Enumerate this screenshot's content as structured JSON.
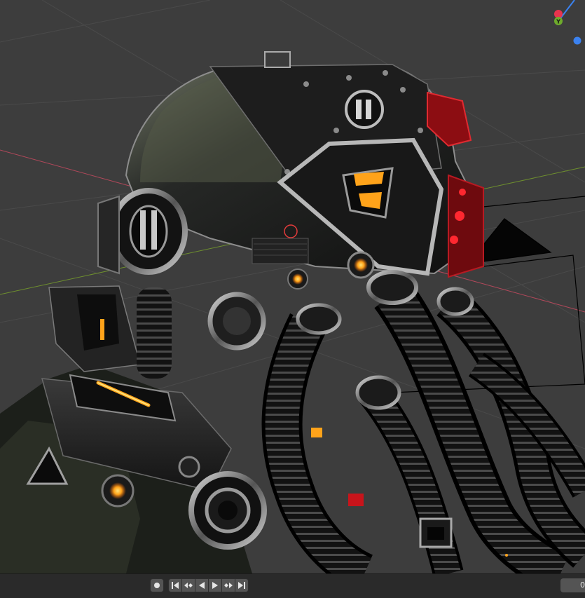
{
  "viewport": {
    "background": "#3d3d3d",
    "grid_color": "#4a4a4a",
    "x_axis_color": "#b0485a",
    "y_axis_color": "#6e8f2e"
  },
  "gizmo": {
    "x_color": "#e8344e",
    "y_color": "#6eab2c",
    "z_color": "#3b82f0",
    "y_label": "Y"
  },
  "model": {
    "glow_color": "#ffa31a",
    "red_light_color": "#d8141e",
    "metal_dark": "#141414",
    "metal_mid": "#2b2b2b",
    "metal_light": "#9a9a9a"
  },
  "timeline": {
    "record_icon": "record-dot-icon",
    "jump_start_icon": "jump-to-start-icon",
    "prev_keyframe_icon": "previous-keyframe-icon",
    "play_reverse_icon": "play-reverse-icon",
    "play_icon": "play-icon",
    "next_keyframe_icon": "next-keyframe-icon",
    "jump_end_icon": "jump-to-end-icon",
    "current_frame": "0"
  }
}
